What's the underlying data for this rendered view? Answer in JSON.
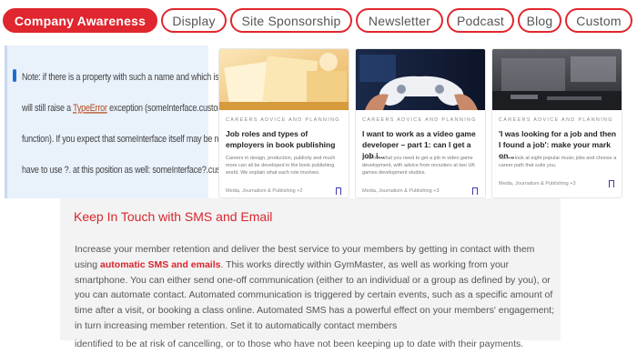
{
  "tabs": [
    {
      "label": "Company Awareness",
      "active": true
    },
    {
      "label": "Display",
      "active": false
    },
    {
      "label": "Site Sponsorship",
      "active": false
    },
    {
      "label": "Newsletter",
      "active": false
    },
    {
      "label": "Podcast",
      "active": false
    },
    {
      "label": "Blog",
      "active": false
    },
    {
      "label": "Custom",
      "active": false
    }
  ],
  "note": {
    "line1": "Note: if there is a property with such a name and which is not a function, using ?.",
    "line2_pre": "will still raise a",
    "line2_code": "TypeError",
    "line2_post": "exception (someInterface.customMethod is not a",
    "line3": "function). If you expect that someInterface itself may be null or undefined, you",
    "line4": "have to use ?. at this position as well: someInterface?.customMethod?.()"
  },
  "cards": [
    {
      "category": "CAREERS ADVICE AND PLANNING",
      "title": "Job roles and types of employers in book publishing",
      "summary": "Careers in design, production, publicity and much more can all be developed in the book publishing world. We explain what each role involves.",
      "footer": "Media, Journalism & Publishing +2"
    },
    {
      "category": "CAREERS ADVICE AND PLANNING",
      "title": "I want to work as a video game developer – part 1: can I get a job i...",
      "summary": "Find out what you need to get a job in video game development, with advice from recruiters at two UK games development studios.",
      "footer": "Media, Journalism & Publishing +3"
    },
    {
      "category": "CAREERS ADVICE AND PLANNING",
      "title": "'I was looking for a job and then I found a job': make your mark on...",
      "summary": "Take a look at eight popular music jobs and choose a career path that suits you.",
      "footer": "Media, Journalism & Publishing +3"
    }
  ],
  "sms": {
    "title": "Keep In Touch with SMS and Email",
    "p_before": "Increase your member retention and deliver the best service to your members by getting in contact with them using ",
    "p_bold": "automatic SMS and emails",
    "p_after": ". This works directly within GymMaster, as well as working from your smartphone. You can either send one-off communication (either to an individual or a group as defined by you), or you can automate contact. Automated communication is triggered by certain events, such as a specific amount of time after a visit, or booking a class online. Automated SMS has a powerful effect on your members' engagement; in turn increasing member retention. Set it to automatically contact members",
    "tail": "identified to be at risk of cancelling, or to those who have not been keeping up to date with their payments."
  },
  "colors": {
    "accent": "#e0262e",
    "note_bg": "#e9f1fb",
    "sms_bg": "#f3f3f3"
  }
}
